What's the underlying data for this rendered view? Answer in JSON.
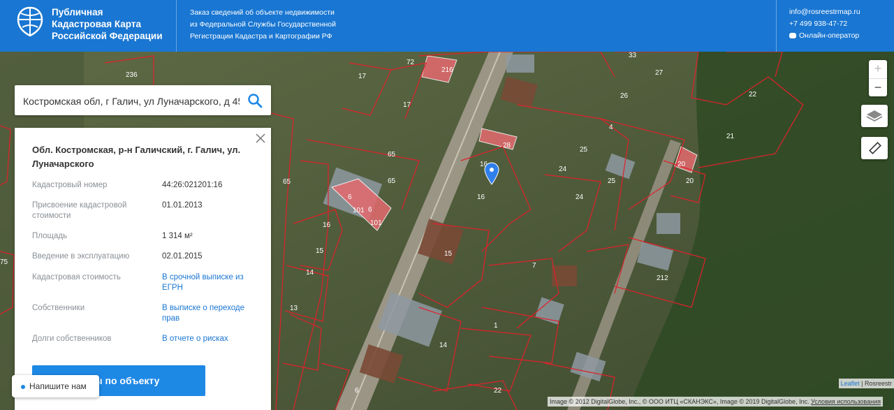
{
  "header": {
    "brand_line1": "Публичная",
    "brand_line2": "Кадастровая Карта",
    "brand_line3": "Российской Федерации",
    "info_line1": "Заказ сведений об объекте недвижимости",
    "info_line2": "из Федеральной Службы Государственной",
    "info_line3": "Регистрации Кадастра и Картографии РФ",
    "email": "info@rosreestrmap.ru",
    "phone": "+7 499 938-47-72",
    "chat": "Онлайн-оператор"
  },
  "search": {
    "value": "Костромская обл, г Галич, ул Луначарского, д 45"
  },
  "panel": {
    "title": "Обл. Костромская, р-н Галичский, г. Галич, ул. Луначарского",
    "rows": [
      {
        "key": "Кадастровый номер",
        "value": "44:26:021201:16",
        "link": false
      },
      {
        "key": "Присвоение кадастровой стоимости",
        "value": "01.01.2013",
        "link": false
      },
      {
        "key": "Площадь",
        "value": "1 314 м²",
        "link": false
      },
      {
        "key": "Введение в эксплуатацию",
        "value": "02.01.2015",
        "link": false
      },
      {
        "key": "Кадастровая стоимость",
        "value": "В срочной выписке из ЕГРН",
        "link": true
      },
      {
        "key": "Собственники",
        "value": "В выписке о переходе прав",
        "link": true
      },
      {
        "key": "Долги собственников",
        "value": "В отчете о рисках",
        "link": true
      }
    ],
    "docs_button": "енты по объекту"
  },
  "chat_pill": "Напишите нам",
  "map": {
    "zoom_in": "+",
    "zoom_out": "−",
    "parcel_numbers": [
      "236",
      "72",
      "216",
      "33",
      "27",
      "17",
      "17",
      "65",
      "65",
      "65",
      "6",
      "101",
      "6",
      "101",
      "16",
      "16",
      "16",
      "28",
      "26",
      "4",
      "22",
      "21",
      "25",
      "24",
      "24",
      "25",
      "20",
      "20",
      "15",
      "15",
      "14",
      "13",
      "7",
      "212",
      "1",
      "14",
      "6",
      "22",
      "75"
    ],
    "attribution_leaflet": "Leaflet",
    "attribution_source": "Rosreestr",
    "attribution_imagery": "Image © 2012 DigitalGlobe, Inc., © ООО ИТЦ «СКАНЭКС», Image © 2019 DigitalGlobe, Inc.",
    "terms": "Условия использования"
  },
  "colors": {
    "header": "#1976d2",
    "accent": "#1e88e5",
    "parcel_border": "#e0212b",
    "building_fill": "#e46a6f"
  }
}
